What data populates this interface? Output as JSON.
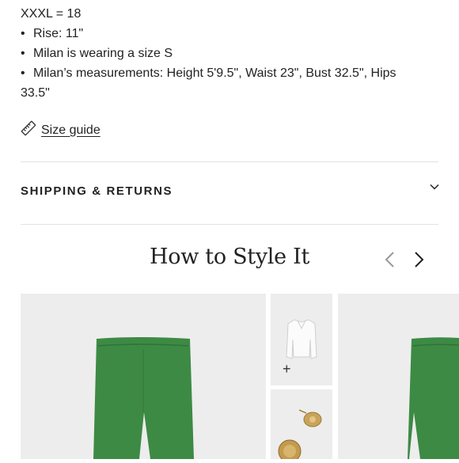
{
  "details": {
    "size_tail": "XXXL = 18",
    "bullets": [
      "Rise: 11\"",
      "Milan is wearing a size S",
      "Milan’s measurements: Height 5'9.5\", Waist 23\", Bust 32.5\", Hips"
    ],
    "bullet_continuation": "33.5\"",
    "bullet_glyph": "•"
  },
  "size_guide": {
    "label": "Size guide",
    "icon": "ruler-icon"
  },
  "shipping": {
    "label": "SHIPPING & RETURNS",
    "icon": "chevron-down-icon"
  },
  "style_section": {
    "title": "How to Style It",
    "prev_icon": "chevron-left-icon",
    "next_icon": "chevron-right-icon",
    "add_label": "+"
  },
  "colors": {
    "pants_green": "#3d8a45",
    "card_bg": "#ededed",
    "text": "#222222",
    "arrow_disabled": "#9a9a9a"
  }
}
